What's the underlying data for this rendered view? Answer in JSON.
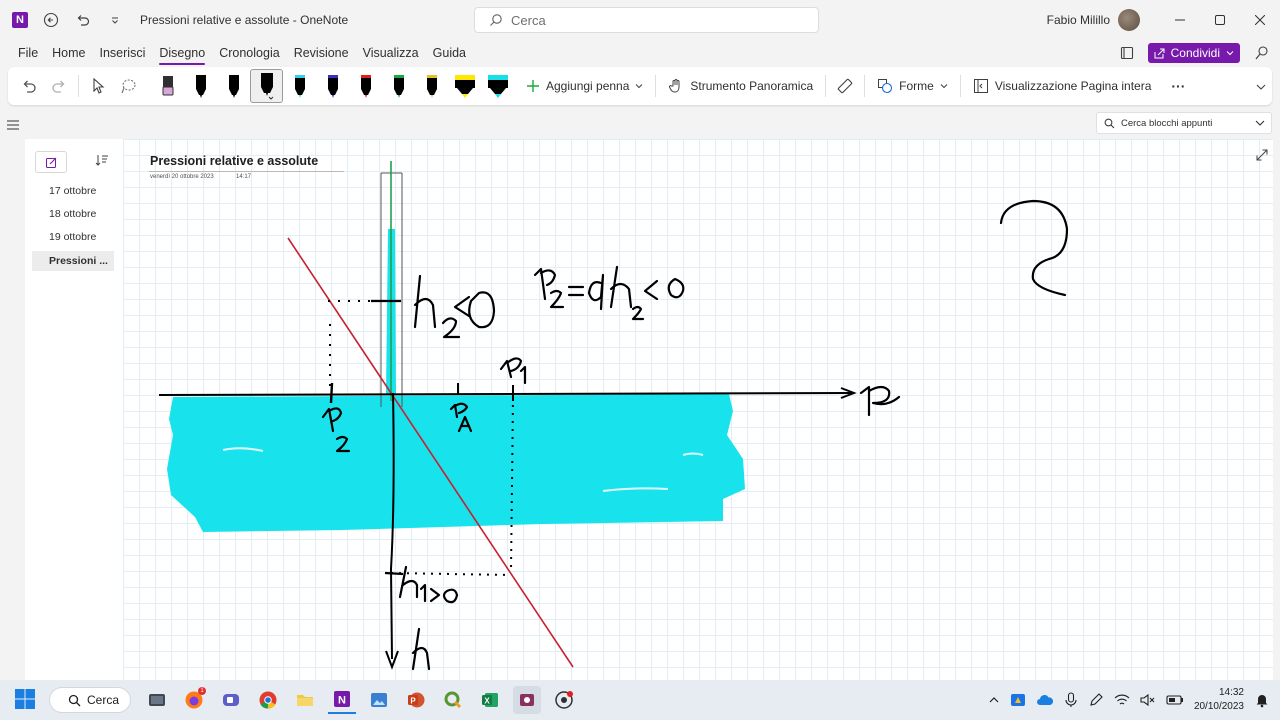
{
  "titlebar": {
    "doc_title": "Pressioni relative e assolute",
    "separator": "-",
    "app_name": "OneNote",
    "search_placeholder": "Cerca",
    "user_name": "Fabio Milillo"
  },
  "menu": {
    "items": [
      "File",
      "Home",
      "Inserisci",
      "Disegno",
      "Cronologia",
      "Revisione",
      "Visualizza",
      "Guida"
    ],
    "active": "Disegno",
    "share_label": "Condividi"
  },
  "ribbon": {
    "add_pen_label": "Aggiungi penna",
    "pan_tool_label": "Strumento Panoramica",
    "shapes_label": "Forme",
    "full_page_view_label": "Visualizzazione Pagina intera",
    "more_label": "···",
    "pens": [
      {
        "color": "#d9a6d9",
        "kind": "eraser"
      },
      {
        "color": "#000000",
        "kind": "pen"
      },
      {
        "color": "#000000",
        "kind": "pen"
      },
      {
        "color": "#000000",
        "kind": "pen-selected"
      },
      {
        "color": "#2bd4e8",
        "kind": "pen"
      },
      {
        "color": "#3a2cc4",
        "kind": "pen"
      },
      {
        "color": "#e02020",
        "kind": "pen"
      },
      {
        "color": "#18a83a",
        "kind": "pen"
      },
      {
        "color": "#e8c020",
        "kind": "pen"
      },
      {
        "color": "#ffe800",
        "kind": "highlighter"
      },
      {
        "color": "#19e0e8",
        "kind": "highlighter"
      }
    ]
  },
  "notebook_search_placeholder": "Cerca blocchi appunti",
  "pages": [
    {
      "label": "17 ottobre"
    },
    {
      "label": "18 ottobre"
    },
    {
      "label": "19 ottobre"
    },
    {
      "label": "Pressioni ...",
      "active": true
    }
  ],
  "page": {
    "title": "Pressioni relative e assolute",
    "date": "venerdì 20 ottobre 2023",
    "time": "14:17"
  },
  "taskbar": {
    "search_label": "Cerca",
    "time": "14:32",
    "date": "20/10/2023",
    "notification_count": "1"
  },
  "colors": {
    "accent": "#7719aa",
    "water": "#18e2ec",
    "ink": "#000000",
    "red_line": "#c8202e",
    "green_line": "#21a050"
  }
}
